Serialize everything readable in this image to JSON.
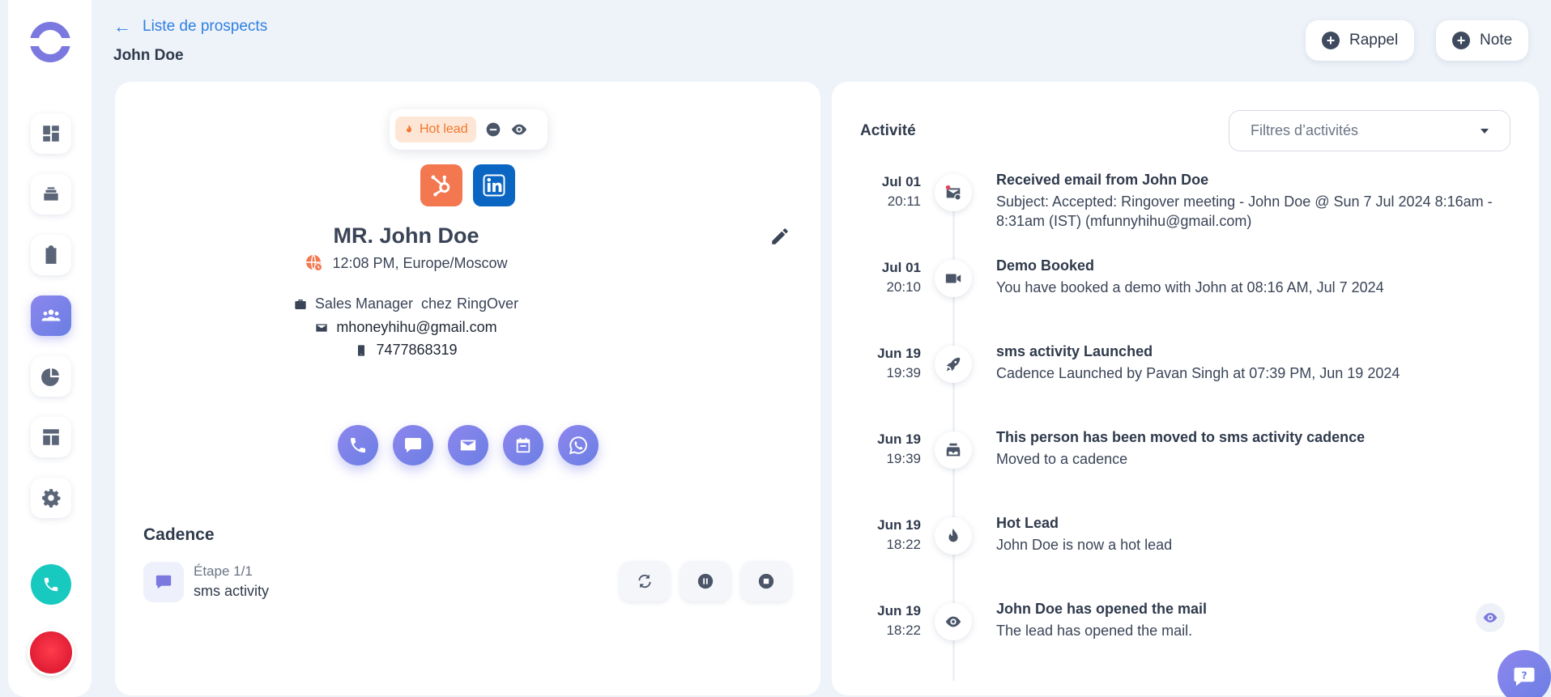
{
  "header": {
    "back_label": "Liste de prospects",
    "title": "John Doe",
    "reminder_label": "Rappel",
    "note_label": "Note"
  },
  "sidebar": {
    "items": [
      {
        "icon": "dashboard-icon"
      },
      {
        "icon": "layers-icon"
      },
      {
        "icon": "clipboard-icon"
      },
      {
        "icon": "people-icon",
        "active": true
      },
      {
        "icon": "pie-chart-icon"
      },
      {
        "icon": "layout-icon"
      },
      {
        "icon": "gear-icon"
      }
    ]
  },
  "contact": {
    "badge": "Hot lead",
    "name": "MR. John Doe",
    "timezone": "12:08 PM, Europe/Moscow",
    "job_title": "Sales Manager",
    "job_prep": "chez",
    "company": "RingOver",
    "email": "mhoneyhihu@gmail.com",
    "phone": "7477868319"
  },
  "cadence": {
    "title": "Cadence",
    "step": "Étape 1/1",
    "name": "sms activity"
  },
  "activity": {
    "title": "Activité",
    "filter_placeholder": "Filtres d’activités",
    "events": [
      {
        "date": "Jul 01",
        "time": "20:11",
        "icon": "email-received-icon",
        "title": "Received email from John Doe",
        "desc": "Subject: Accepted: Ringover meeting - John Doe @ Sun 7 Jul 2024 8:16am - 8:31am (IST) (mfunnyhihu@gmail.com)"
      },
      {
        "date": "Jul 01",
        "time": "20:10",
        "icon": "video-icon",
        "title": "Demo Booked",
        "desc": "You have booked a demo with John at 08:16 AM, Jul 7 2024"
      },
      {
        "date": "Jun 19",
        "time": "19:39",
        "icon": "rocket-icon",
        "title": "sms activity Launched",
        "desc": "Cadence Launched by Pavan Singh at 07:39 PM, Jun 19 2024"
      },
      {
        "date": "Jun 19",
        "time": "19:39",
        "icon": "inbox-icon",
        "title": "This person has been moved to sms activity cadence",
        "desc": "Moved to a cadence"
      },
      {
        "date": "Jun 19",
        "time": "18:22",
        "icon": "fire-icon",
        "title": "Hot Lead",
        "desc": "John Doe is now a hot lead"
      },
      {
        "date": "Jun 19",
        "time": "18:22",
        "icon": "eye-icon",
        "title": "John Doe has opened the mail",
        "desc": "The lead has opened the mail."
      }
    ]
  },
  "colors": {
    "accent": "#7b78e0",
    "link": "#2f7fe0",
    "hot": "#f0772b",
    "teal": "#17c9be"
  }
}
